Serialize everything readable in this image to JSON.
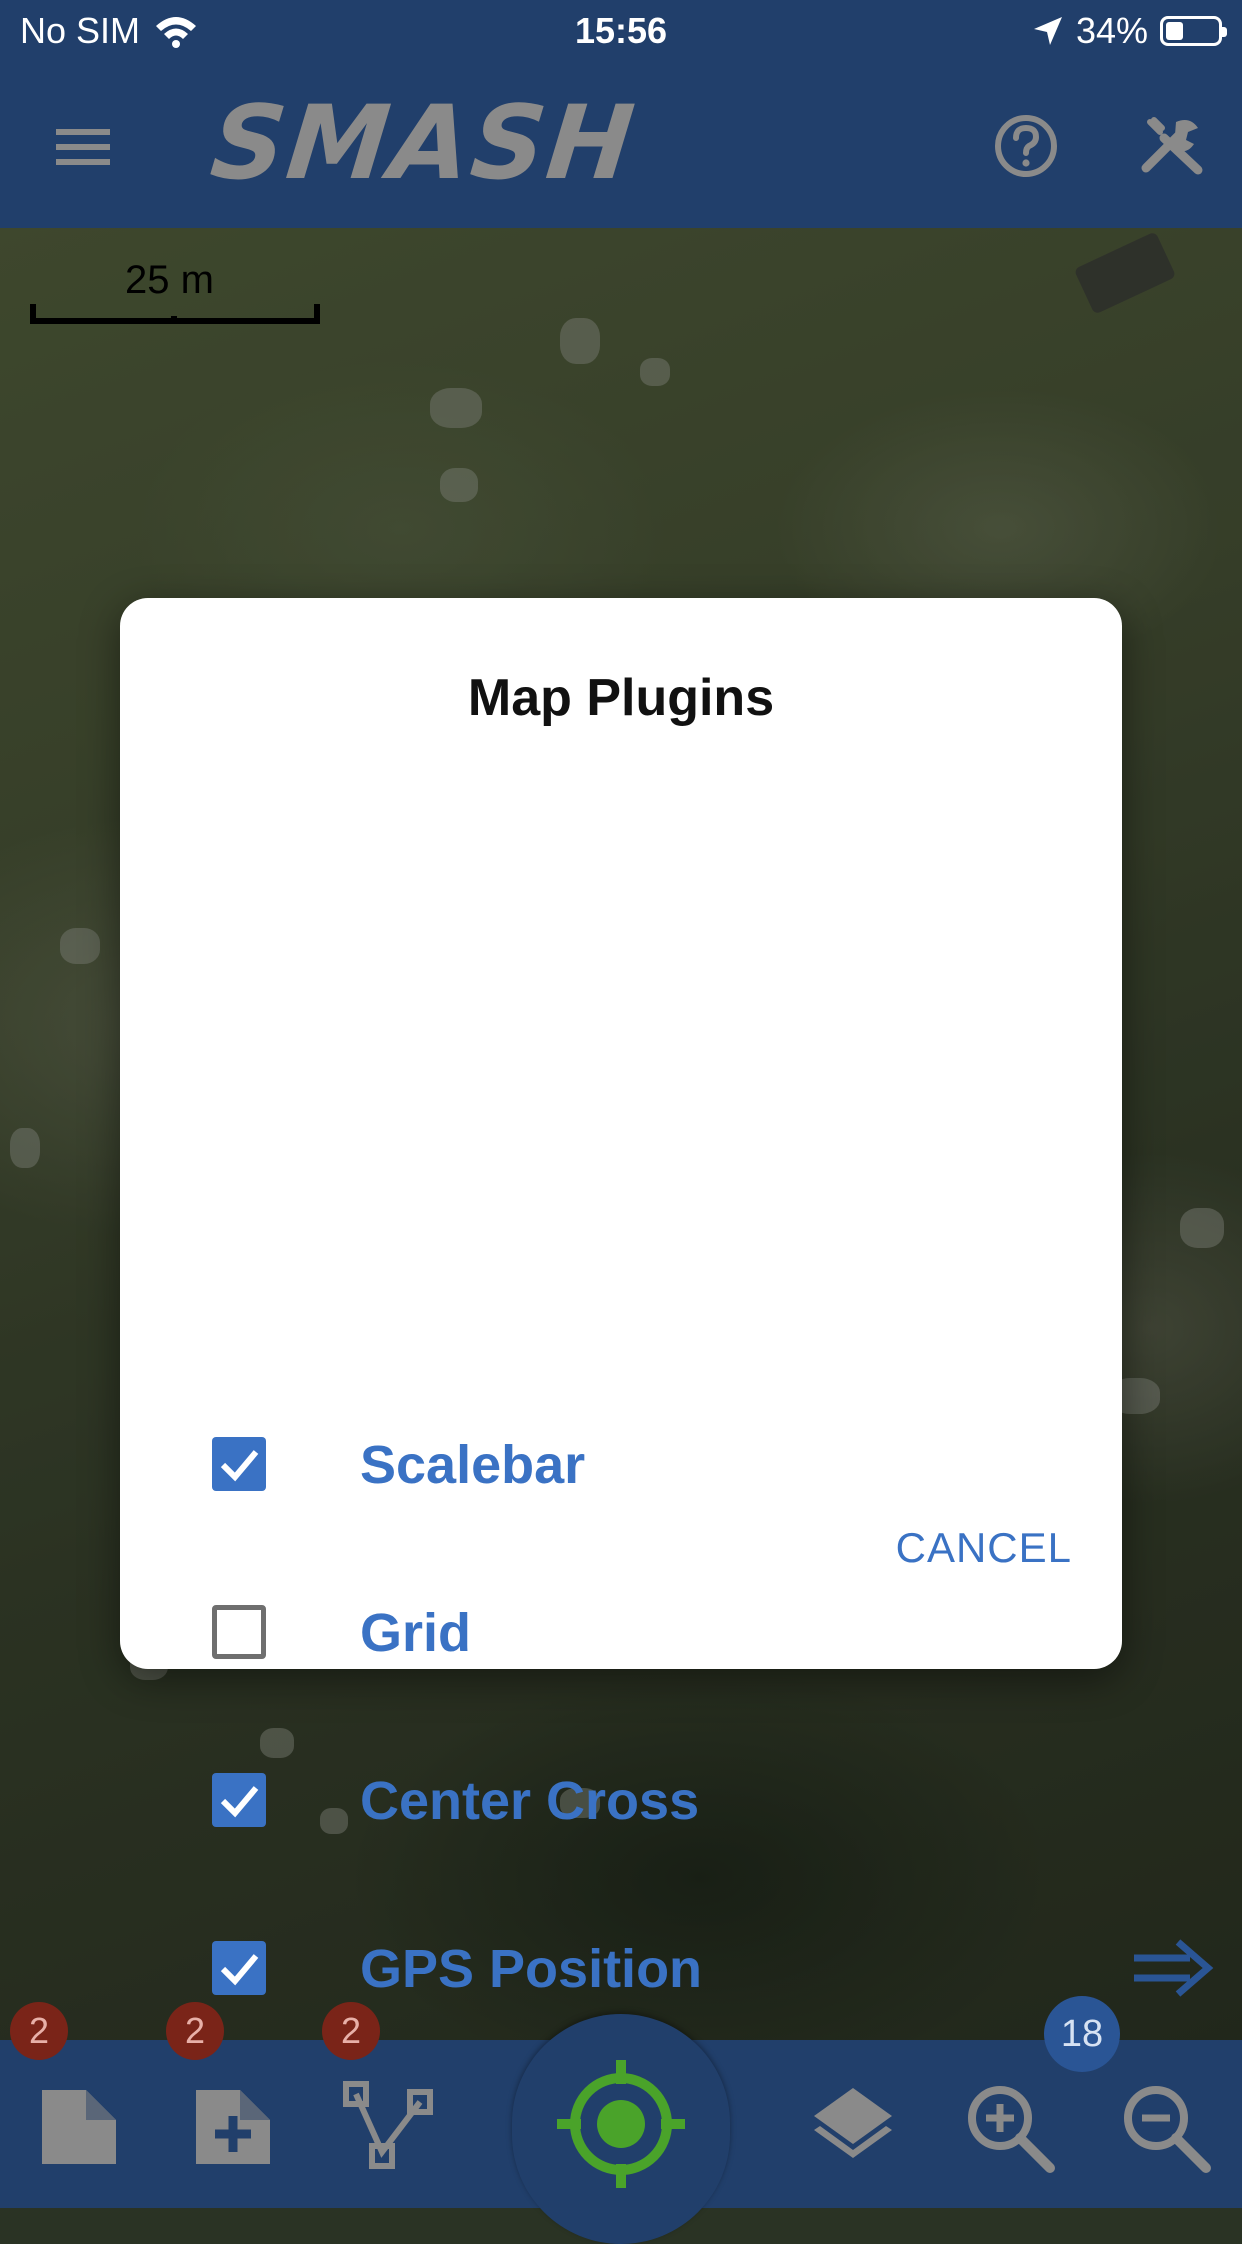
{
  "status_bar": {
    "carrier": "No SIM",
    "time": "15:56",
    "battery_percent_text": "34%",
    "battery_level": 0.34,
    "icons": [
      "wifi-icon",
      "location-arrow-icon",
      "battery-icon"
    ]
  },
  "app_bar": {
    "logo": "SMASH",
    "icons": [
      "menu-icon",
      "help-icon",
      "tools-icon"
    ]
  },
  "map": {
    "scalebar_label": "25 m"
  },
  "dialog": {
    "title": "Map Plugins",
    "options": [
      {
        "label": "Scalebar",
        "checked": true
      },
      {
        "label": "Grid",
        "checked": false
      },
      {
        "label": "Center Cross",
        "checked": true
      },
      {
        "label": "GPS Position",
        "checked": true
      }
    ],
    "cancel_label": "CANCEL"
  },
  "bottom_bar": {
    "notes_count": "2",
    "add_note_count": "2",
    "logs_count": "2",
    "zoom_level": "18",
    "icons": [
      "notes-icon",
      "add-note-icon",
      "gps-logs-icon",
      "gps-target-icon",
      "layers-icon",
      "zoom-in-icon",
      "zoom-out-icon",
      "double-arrow-right-icon"
    ]
  },
  "colors": {
    "primary": "#213f6b",
    "accent": "#3a72c4",
    "badge": "#7a2418",
    "gps": "#4aa32a"
  }
}
